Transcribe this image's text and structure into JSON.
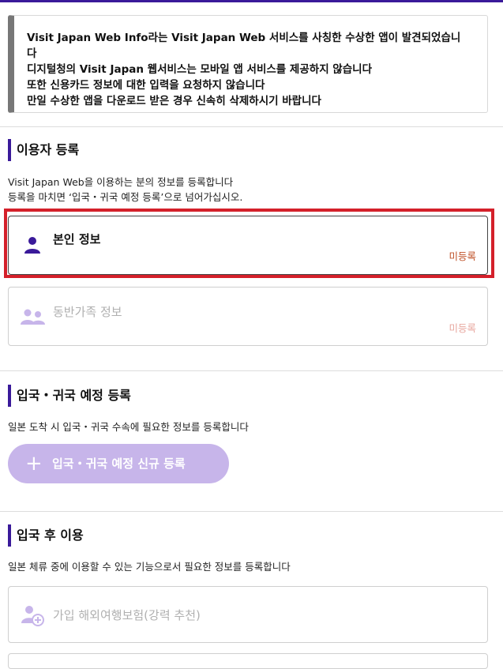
{
  "notice": {
    "lines": [
      "Visit Japan Web Info라는 Visit Japan Web 서비스를 사칭한 수상한 앱이 발견되었습니",
      "다",
      "디지털청의 Visit Japan 웹서비스는 모바일 앱 서비스를 제공하지 않습니다",
      "또한 신용카드 정보에 대한 입력을 요청하지 않습니다",
      "만일 수상한 앱을 다운로드 받은 경우 신속히 삭제하시기 바랍니다"
    ]
  },
  "user_registration": {
    "title": "이용자 등록",
    "desc_line1": "Visit Japan Web을 이용하는 분의 정보를 등록합니다",
    "desc_line2": "등록을 마치면 ‘입국・귀국 예정 등록’으로 넘어가십시오.",
    "self_info": {
      "label": "본인 정보",
      "status": "미등록",
      "icon": "person-icon"
    },
    "family_info": {
      "label": "동반가족 정보",
      "status": "미등록",
      "icon": "family-icon"
    }
  },
  "entry_plan": {
    "title": "입국・귀국 예정 등록",
    "desc": "일본 도착 시 입국・귀국 수속에 필요한 정보를 등록합니다",
    "button_plus": "+",
    "button_label": "입국・귀국 예정 신규 등록"
  },
  "after_entry": {
    "title": "입국 후 이용",
    "desc": "일본 체류 중에 이용할 수 있는 기능으로서 필요한 정보를 등록합니다",
    "insurance_label": "가입 해외여행보험(강력 추천)",
    "insurance_icon": "insurance-person-icon"
  },
  "colors": {
    "brand": "#3a1a9a",
    "status_unregistered": "#c0532a",
    "disabled_text": "#b0b0b0",
    "highlight": "#d4202a",
    "button_disabled": "#c7b5ea"
  }
}
